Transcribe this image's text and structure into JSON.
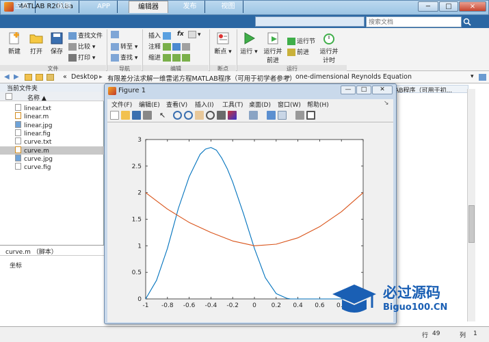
{
  "window": {
    "title": "MATLAB R2018a",
    "min": "−",
    "max": "□",
    "close": "×"
  },
  "tabs": [
    {
      "label": "主页"
    },
    {
      "label": "绘图"
    },
    {
      "label": "APP"
    },
    {
      "label": "编辑器"
    },
    {
      "label": "发布"
    },
    {
      "label": "视图"
    }
  ],
  "search": {
    "placeholder": "搜索文档"
  },
  "ribbon": {
    "file": {
      "new": "新建",
      "open": "打开",
      "save": "保存",
      "find_files": "查找文件",
      "compare": "比较",
      "print": "打印",
      "group": "文件"
    },
    "navigate": {
      "goto": "转至",
      "find": "查找",
      "group": "导航"
    },
    "edit": {
      "insert": "插入",
      "comment": "注释",
      "indent": "缩进",
      "fx": "fx",
      "group": "编辑"
    },
    "breakpoints": {
      "label": "断点",
      "group": "断点"
    },
    "run": {
      "run": "运行",
      "run_advance_1": "运行并",
      "run_advance_2": "前进",
      "run_section": "运行节",
      "advance": "前进",
      "run_time_1": "运行并",
      "run_time_2": "计时",
      "group": "运行"
    }
  },
  "path": {
    "prefix": "«",
    "parts": [
      "Desktop",
      "有限差分法求解一维雷诺方程MATLAB程序（可用于初学者参考）",
      "one-dimensional Reynolds Equation"
    ],
    "sep": "▸"
  },
  "current_folder": {
    "title": "当前文件夹",
    "name_header": "名称 ▲",
    "files": [
      "linear.txt",
      "linear.m",
      "linear.jpg",
      "linear.fig",
      "curve.txt",
      "curve.m",
      "curve.jpg",
      "curve.fig"
    ],
    "selected": "curve.m"
  },
  "details": {
    "title": "curve.m （脚本）",
    "content": "坐标"
  },
  "editor_tab": {
    "label": "ATLAB程序（可用于初..."
  },
  "statusbar": {
    "row_label": "行",
    "row": "49",
    "col_label": "列",
    "col": "1"
  },
  "figure": {
    "title": "Figure 1",
    "menu": [
      "文件(F)",
      "编辑(E)",
      "查看(V)",
      "插入(I)",
      "工具(T)",
      "桌面(D)",
      "窗口(W)",
      "帮助(H)"
    ],
    "min": "—",
    "max": "□",
    "close": "✕"
  },
  "chart_data": {
    "type": "line",
    "xlim": [
      -1,
      1
    ],
    "ylim": [
      0,
      3
    ],
    "xticks": [
      -1,
      -0.8,
      -0.6,
      -0.4,
      -0.2,
      0,
      0.2,
      0.4,
      0.6,
      0.8,
      1
    ],
    "xticklabels": [
      "-1",
      "-0.8",
      "-0.6",
      "-0.4",
      "-0.2",
      "0",
      "0.2",
      "0.4",
      "0.6",
      "0.8",
      "1"
    ],
    "yticks": [
      0,
      0.5,
      1,
      1.5,
      2,
      2.5,
      3
    ],
    "yticklabels": [
      "0",
      "0.5",
      "1",
      "1.5",
      "2",
      "2.5",
      "3"
    ],
    "grid": false,
    "series": [
      {
        "color": "#0072bd",
        "x": [
          -1,
          -0.9,
          -0.8,
          -0.7,
          -0.6,
          -0.5,
          -0.45,
          -0.4,
          -0.35,
          -0.3,
          -0.25,
          -0.2,
          -0.1,
          0,
          0.1,
          0.2,
          0.3,
          0.33,
          0.4,
          0.6,
          0.8,
          1
        ],
        "y": [
          0,
          0.35,
          0.95,
          1.7,
          2.3,
          2.72,
          2.82,
          2.85,
          2.8,
          2.65,
          2.45,
          2.2,
          1.6,
          0.95,
          0.4,
          0.1,
          0.01,
          0,
          0,
          0,
          0,
          0
        ]
      },
      {
        "color": "#d95319",
        "x": [
          -1,
          -0.8,
          -0.6,
          -0.4,
          -0.2,
          0,
          0.2,
          0.4,
          0.6,
          0.8,
          1
        ],
        "y": [
          2.0,
          1.69,
          1.44,
          1.25,
          1.09,
          1.0,
          1.03,
          1.15,
          1.36,
          1.64,
          2.0
        ]
      }
    ]
  },
  "watermark": {
    "line1": "必过源码",
    "line2": "Biguo100.CN"
  },
  "colors": {
    "accent": "#2b67a3",
    "series1": "#0072bd",
    "series2": "#d95319"
  }
}
